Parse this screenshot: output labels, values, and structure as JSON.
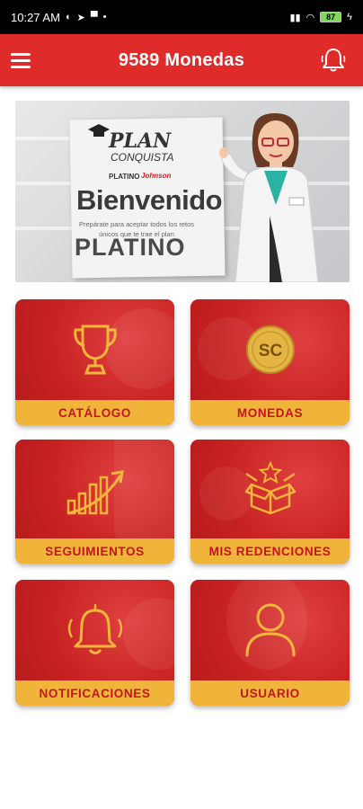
{
  "status_bar": {
    "time": "10:27 AM",
    "battery": "87"
  },
  "app_bar": {
    "title": "9589 Monedas"
  },
  "banner": {
    "plan": "PLAN",
    "conquista": "CONQUISTA",
    "platino_small": "PLATINO",
    "bienvenido": "Bienvenido",
    "subtitle": "Prepárate para aceptar todos los retos únicos que te trae el plan",
    "platino": "PLATINO"
  },
  "cards": [
    {
      "label": "CATÁLOGO",
      "icon": "trophy-icon"
    },
    {
      "label": "MONEDAS",
      "icon": "coin-icon"
    },
    {
      "label": "SEGUIMIENTOS",
      "icon": "growth-chart-icon"
    },
    {
      "label": "MIS REDENCIONES",
      "icon": "gift-box-icon"
    },
    {
      "label": "NOTIFICACIONES",
      "icon": "bell-icon"
    },
    {
      "label": "USUARIO",
      "icon": "user-icon"
    }
  ],
  "colors": {
    "primary_red": "#e02b2b",
    "card_red": "#c82222",
    "label_yellow": "#f0b43a",
    "label_text": "#c4151c",
    "icon_gold": "#f2b63b"
  }
}
